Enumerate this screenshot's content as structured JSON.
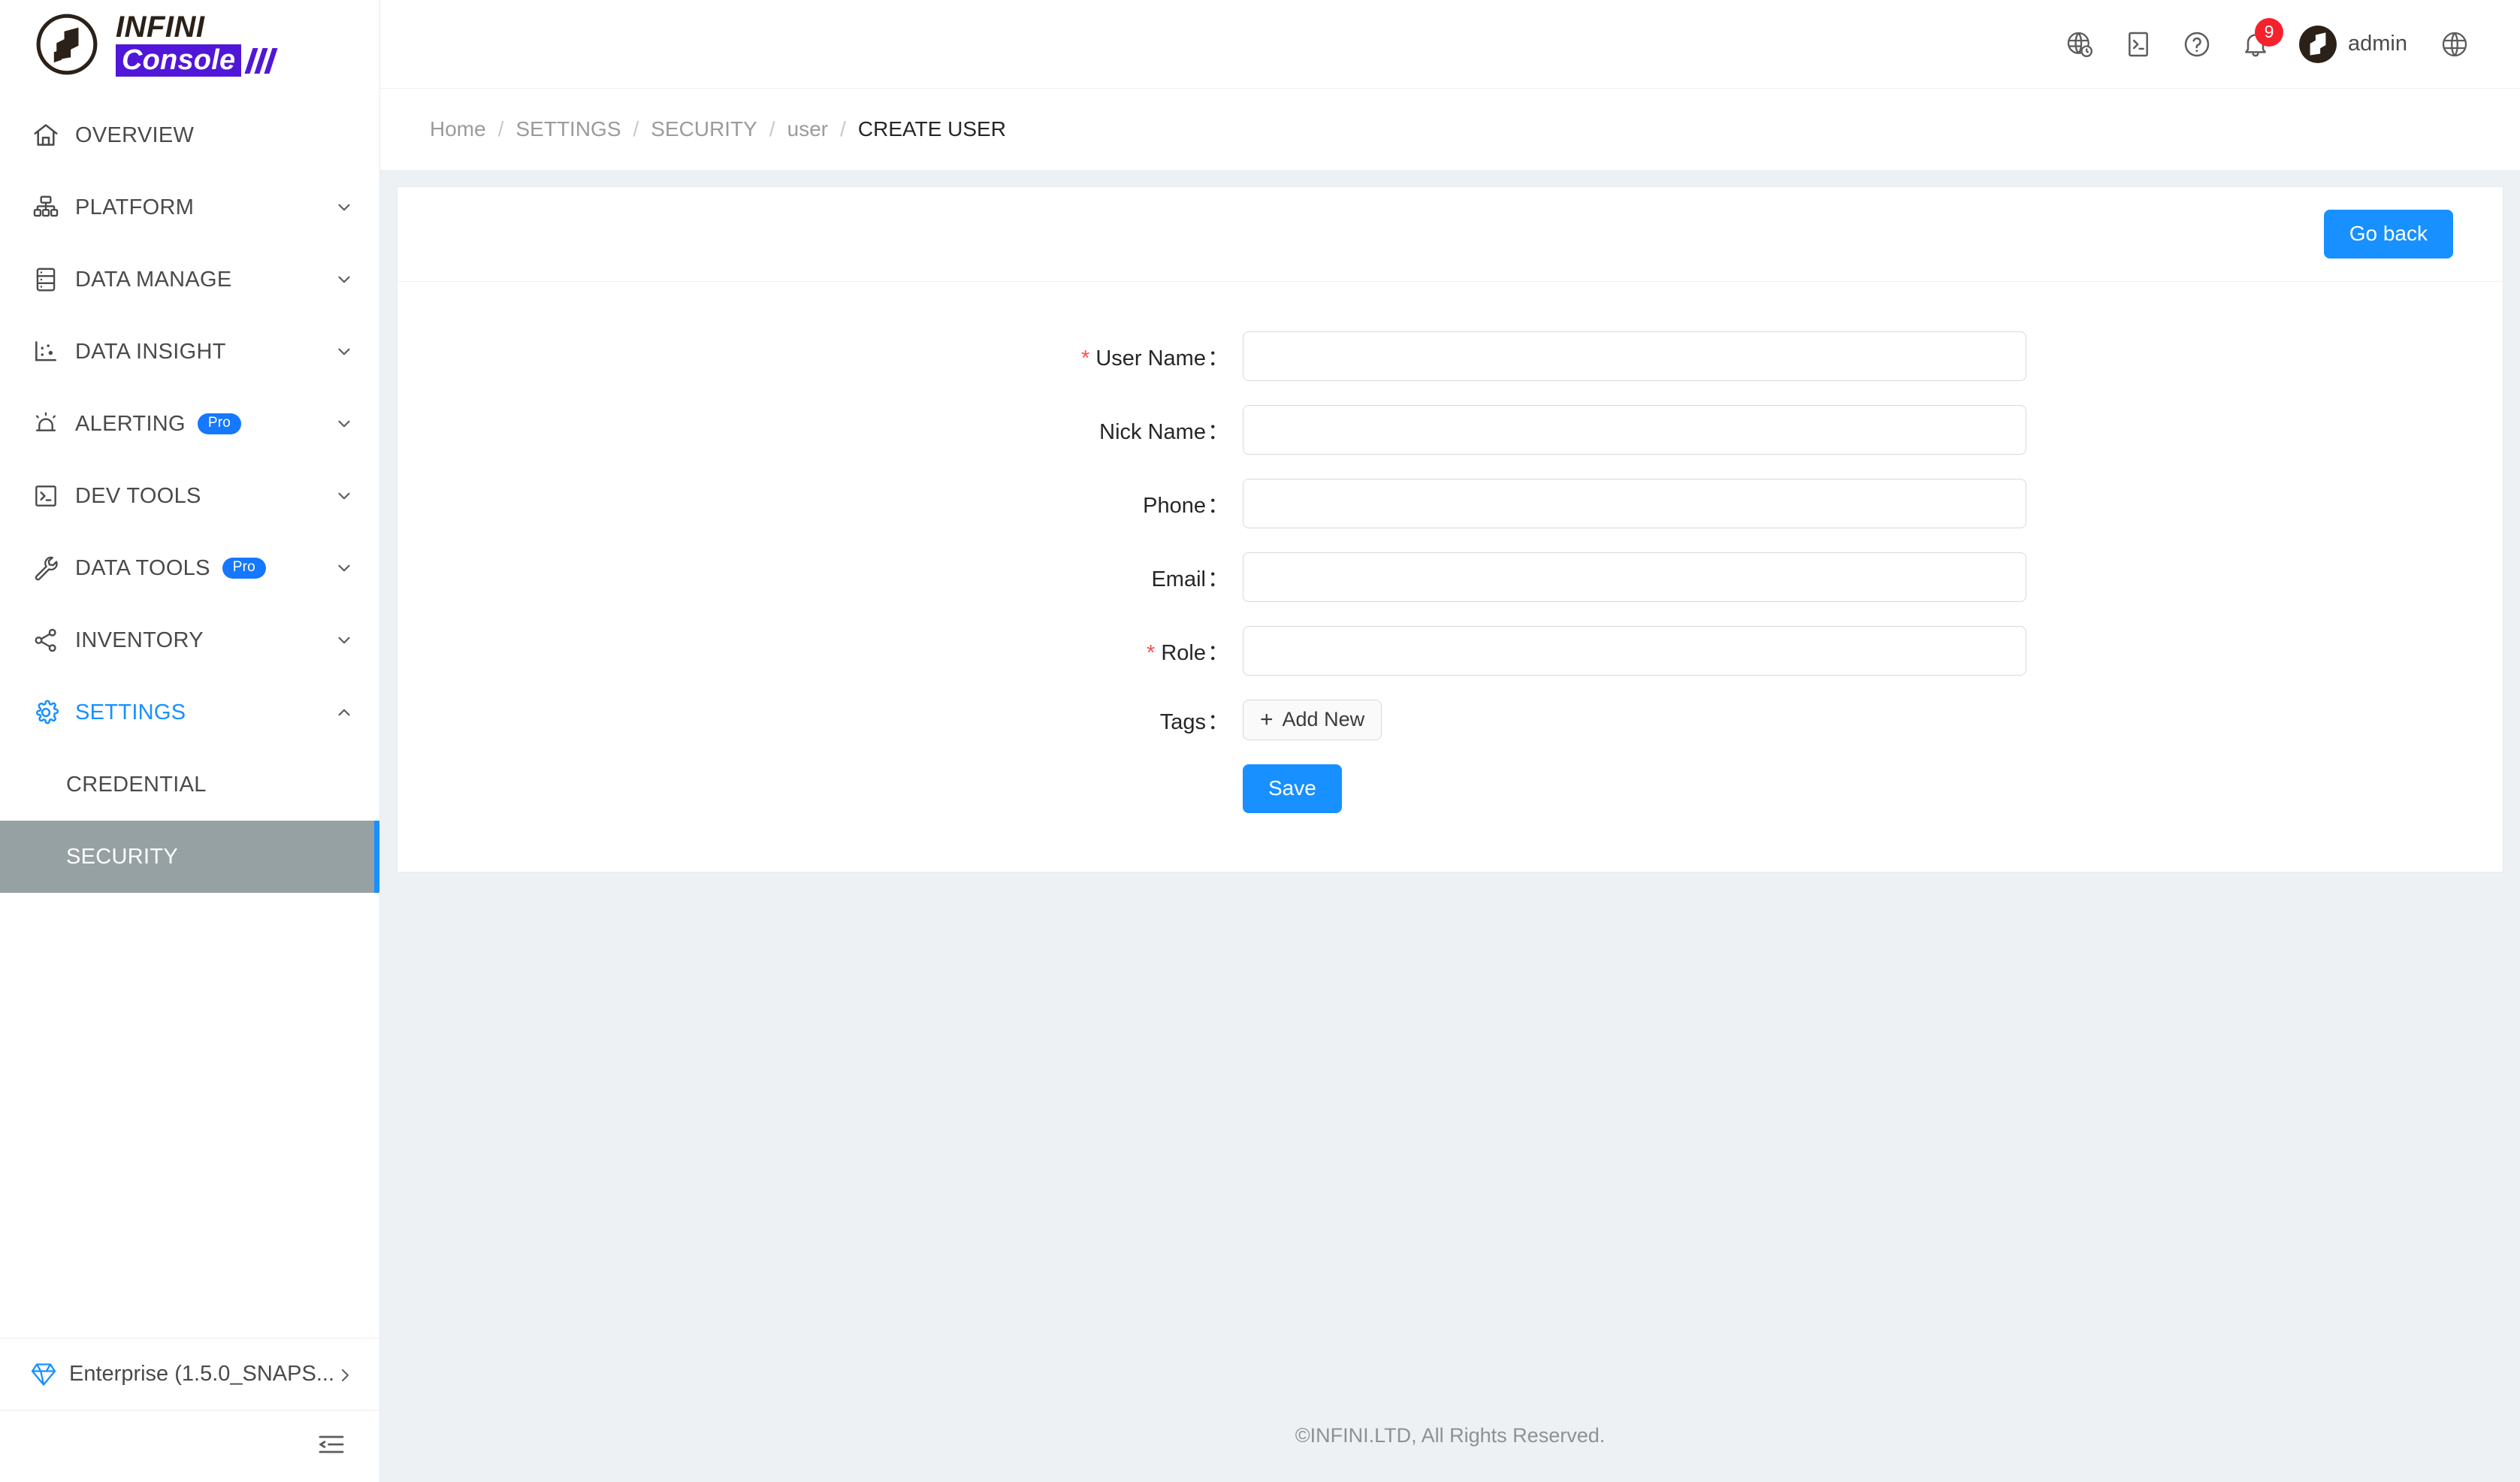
{
  "brand": {
    "logo_top": "INFINI",
    "logo_bottom": "Console",
    "accent": "#5117d8"
  },
  "sidebar": {
    "items": [
      {
        "label": "OVERVIEW",
        "icon": "home-icon",
        "expandable": false,
        "pro": false,
        "state": "normal"
      },
      {
        "label": "PLATFORM",
        "icon": "cluster-icon",
        "expandable": true,
        "pro": false,
        "state": "normal"
      },
      {
        "label": "DATA MANAGE",
        "icon": "database-icon",
        "expandable": true,
        "pro": false,
        "state": "normal"
      },
      {
        "label": "DATA INSIGHT",
        "icon": "chart-icon",
        "expandable": true,
        "pro": false,
        "state": "normal"
      },
      {
        "label": "ALERTING",
        "icon": "alarm-icon",
        "expandable": true,
        "pro": true,
        "state": "normal"
      },
      {
        "label": "DEV TOOLS",
        "icon": "terminal-icon",
        "expandable": true,
        "pro": false,
        "state": "normal"
      },
      {
        "label": "DATA TOOLS",
        "icon": "wrench-icon",
        "expandable": true,
        "pro": true,
        "state": "normal"
      },
      {
        "label": "INVENTORY",
        "icon": "share-icon",
        "expandable": true,
        "pro": false,
        "state": "normal"
      },
      {
        "label": "SETTINGS",
        "icon": "gear-icon",
        "expandable": true,
        "pro": false,
        "state": "active-expanded"
      }
    ],
    "pro_badge_label": "Pro",
    "sub_items": [
      {
        "label": "CREDENTIAL",
        "selected": false
      },
      {
        "label": "SECURITY",
        "selected": true
      }
    ],
    "footer": {
      "label": "Enterprise (1.5.0_SNAPS...",
      "icon": "gem-icon",
      "arrow": "chevron-right-icon"
    },
    "collapse_icon": "menu-fold-icon",
    "selected_bg": "#96a1a3",
    "selected_accent": "#1890ff"
  },
  "topbar": {
    "icons": [
      {
        "name": "globe-clock-icon"
      },
      {
        "name": "console-terminal-icon"
      },
      {
        "name": "help-circle-icon"
      },
      {
        "name": "bell-icon",
        "badge": "9"
      }
    ],
    "badge_color": "#f5222d",
    "user": {
      "name": "admin",
      "avatar": "infini-avatar-icon"
    },
    "language_icon": "globe-icon"
  },
  "breadcrumb": {
    "items": [
      "Home",
      "SETTINGS",
      "SECURITY",
      "user",
      "CREATE USER"
    ],
    "separator": "/"
  },
  "card": {
    "go_back_label": "Go back",
    "primary_color": "#1890ff"
  },
  "form": {
    "fields": [
      {
        "label": "User Name",
        "required": true,
        "value": "",
        "placeholder": "",
        "type": "input"
      },
      {
        "label": "Nick Name",
        "required": false,
        "value": "",
        "placeholder": "",
        "type": "input"
      },
      {
        "label": "Phone",
        "required": false,
        "value": "",
        "placeholder": "",
        "type": "input"
      },
      {
        "label": "Email",
        "required": false,
        "value": "",
        "placeholder": "",
        "type": "input"
      },
      {
        "label": "Role",
        "required": true,
        "value": "",
        "placeholder": "",
        "type": "input"
      },
      {
        "label": "Tags",
        "required": false,
        "type": "add-new",
        "add_new_label": "Add New",
        "add_new_glyph": "+"
      }
    ],
    "colon": "：",
    "required_mark": "*",
    "save_label": "Save"
  },
  "footer": {
    "text": "©INFINI.LTD, All Rights Reserved."
  }
}
